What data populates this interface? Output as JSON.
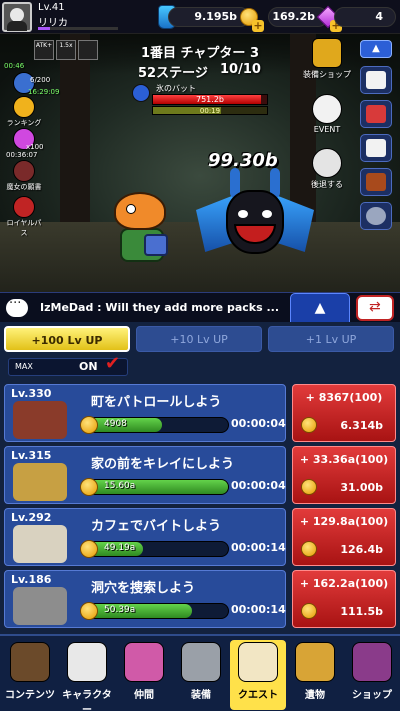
{
  "player": {
    "level": "Lv.41",
    "name": "リリカ",
    "xp_fraction": 0.15
  },
  "currency": {
    "gold": "9.195b",
    "gems": "169.2b",
    "keys": "4"
  },
  "stage": {
    "chapter_title": "1番目 チャプター 3",
    "stage_label": "52ステージ",
    "progress": "10/10",
    "enemy_name": "氷のバット",
    "enemy_hp": "751.2b",
    "enemy_hp_fraction": 0.95,
    "timer": "00:19",
    "timer_fraction": 0.6,
    "damage": "99.30b"
  },
  "left_panel": {
    "timer1": "00:46",
    "counter": "6/200",
    "timer2": "16:29:09",
    "ranking_label": "ランキング",
    "gem_reward": "x100",
    "timer3": "00:36:07",
    "event1_label": "魔女の願書",
    "event2_label": "ロイヤルパ\nス"
  },
  "buffs": [
    "ATK+",
    "1.5x",
    ""
  ],
  "right_panel": {
    "shop_label": "装備ショップ",
    "event_label": "EVENT",
    "skip_label": "後退する"
  },
  "chat": {
    "message": "IzMeDad : Will they add more packs ..."
  },
  "level_tabs": [
    "+100 Lv UP",
    "+10 Lv UP",
    "+1 Lv UP"
  ],
  "max_toggle": {
    "label": "MAX",
    "state": "ON"
  },
  "quests": [
    {
      "level": "Lv.330",
      "name": "町をパトロールしよう",
      "reward": "4908",
      "progress": 0.55,
      "time": "00:00:04",
      "increase": "+ 8367(100)",
      "cost": "6.314b",
      "color": "#8a3b2a"
    },
    {
      "level": "Lv.315",
      "name": "家の前をキレイにしよう",
      "reward": "15.60a",
      "progress": 1.0,
      "time": "00:00:04",
      "increase": "+ 33.36a(100)",
      "cost": "31.00b",
      "color": "#c7a043"
    },
    {
      "level": "Lv.292",
      "name": "カフェでバイトしよう",
      "reward": "49.19a",
      "progress": 0.42,
      "time": "00:00:14",
      "increase": "+ 129.8a(100)",
      "cost": "126.4b",
      "color": "#d9d2c0"
    },
    {
      "level": "Lv.186",
      "name": "洞穴を捜索しよう",
      "reward": "50.39a",
      "progress": 0.75,
      "time": "00:00:14",
      "increase": "+ 162.2a(100)",
      "cost": "111.5b",
      "color": "#8d8d8d"
    }
  ],
  "nav": [
    {
      "label": "コンテンツ",
      "icon": "contents-icon",
      "color": "#6b4a2a"
    },
    {
      "label": "キャラクター",
      "icon": "character-icon",
      "color": "#e8e8e8"
    },
    {
      "label": "仲間",
      "icon": "companion-icon",
      "color": "#d05aa8"
    },
    {
      "label": "装備",
      "icon": "equipment-icon",
      "color": "#9aa0a8"
    },
    {
      "label": "クエスト",
      "icon": "quest-icon",
      "color": "#f2e6c4"
    },
    {
      "label": "遺物",
      "icon": "relic-icon",
      "color": "#d8a436"
    },
    {
      "label": "ショップ",
      "icon": "shop-icon",
      "color": "#8a3b8a"
    }
  ]
}
